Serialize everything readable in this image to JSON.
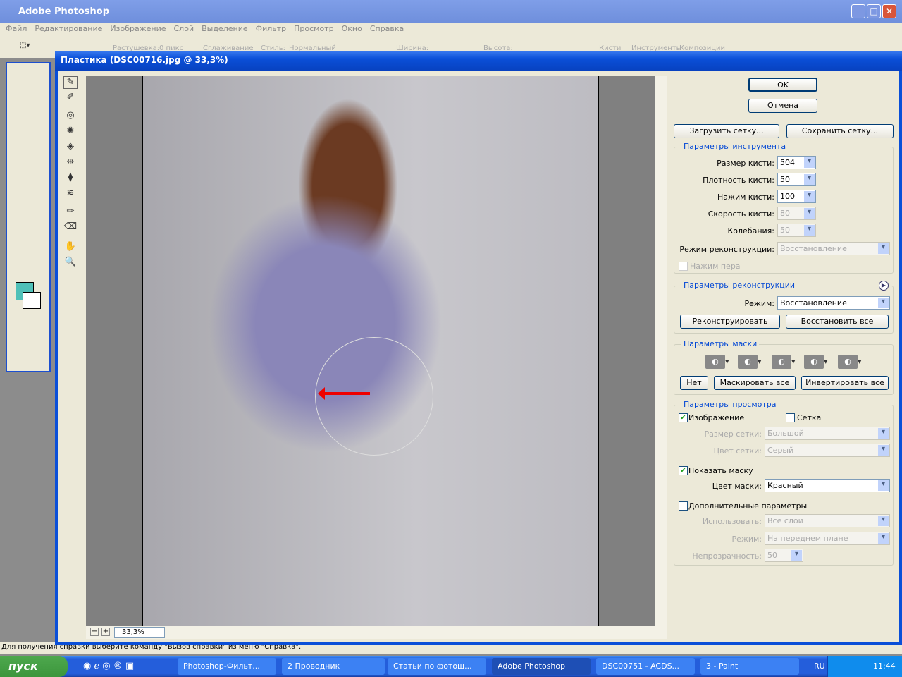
{
  "app": {
    "title": "Adobe Photoshop",
    "menu": [
      "Файл",
      "Редактирование",
      "Изображение",
      "Слой",
      "Выделение",
      "Фильтр",
      "Просмотр",
      "Окно",
      "Справка"
    ],
    "options": {
      "feather_label": "Растушевка:",
      "feather_value": "0 пикс",
      "antialias": "Сглаживание",
      "style_label": "Стиль:",
      "style_value": "Нормальный",
      "width_label": "Ширина:",
      "height_label": "Высота:",
      "tabs": [
        "Кисти",
        "Инструменты",
        "Композиции"
      ]
    },
    "status": "Для получения справки выберите команду \"Вызов справки\" из меню \"Справка\"."
  },
  "dialog": {
    "title": "Пластика (DSC00716.jpg @ 33,3%)",
    "zoom": "33,3%",
    "ok": "OK",
    "cancel": "Отмена",
    "load_mesh": "Загрузить сетку...",
    "save_mesh": "Сохранить сетку...",
    "tool_params": {
      "title": "Параметры инструмента",
      "brush_size_label": "Размер кисти:",
      "brush_size": "504",
      "brush_density_label": "Плотность кисти:",
      "brush_density": "50",
      "brush_pressure_label": "Нажим кисти:",
      "brush_pressure": "100",
      "brush_rate_label": "Скорость кисти:",
      "brush_rate": "80",
      "turbulence_label": "Колебания:",
      "turbulence": "50",
      "recon_mode_label": "Режим реконструкции:",
      "recon_mode": "Восстановление",
      "stylus": "Нажим пера"
    },
    "recon": {
      "title": "Параметры реконструкции",
      "mode_label": "Режим:",
      "mode": "Восстановление",
      "reconstruct": "Реконструировать",
      "restore_all": "Восстановить все"
    },
    "mask": {
      "title": "Параметры маски",
      "none": "Нет",
      "mask_all": "Маскировать все",
      "invert_all": "Инвертировать все"
    },
    "view": {
      "title": "Параметры просмотра",
      "image": "Изображение",
      "image_checked": true,
      "mesh": "Сетка",
      "mesh_checked": false,
      "mesh_size_label": "Размер сетки:",
      "mesh_size": "Большой",
      "mesh_color_label": "Цвет сетки:",
      "mesh_color": "Серый",
      "show_mask": "Показать маску",
      "show_mask_checked": true,
      "mask_color_label": "Цвет маски:",
      "mask_color": "Красный",
      "extra": "Дополнительные параметры",
      "extra_checked": false,
      "use_label": "Использовать:",
      "use": "Все слои",
      "mode_label": "Режим:",
      "mode": "На переднем плане",
      "opacity_label": "Непрозрачность:",
      "opacity": "50"
    }
  },
  "taskbar": {
    "start": "пуск",
    "tasks": [
      "Photoshop-Фильт...",
      "2 Проводник",
      "Статьи по фотош...",
      "Adobe Photoshop",
      "DSC00751 - ACDS...",
      "3 - Paint"
    ],
    "lang": "RU",
    "clock": "11:44"
  }
}
